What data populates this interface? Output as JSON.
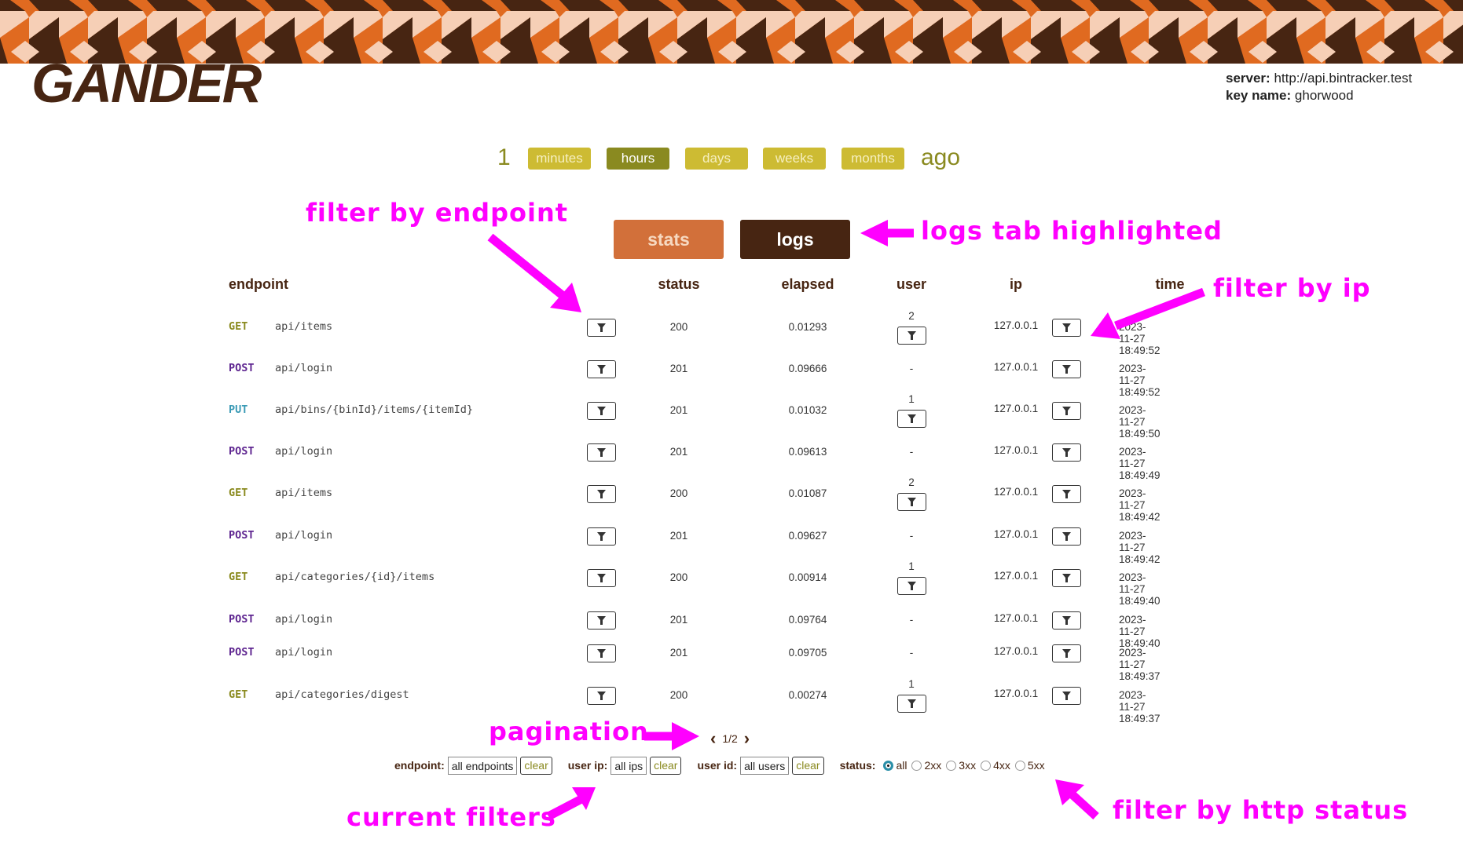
{
  "app": {
    "logo": "GANDER",
    "server_label": "server:",
    "server": "http://api.bintracker.test",
    "key_label": "key name:",
    "key": "ghorwood"
  },
  "range": {
    "value": "1",
    "units": [
      {
        "label": "minutes",
        "active": false
      },
      {
        "label": "hours",
        "active": true
      },
      {
        "label": "days",
        "active": false
      },
      {
        "label": "weeks",
        "active": false
      },
      {
        "label": "months",
        "active": false
      }
    ],
    "suffix": "ago"
  },
  "tabs": {
    "stats": "stats",
    "logs": "logs",
    "active": "logs"
  },
  "columns": {
    "endpoint": "endpoint",
    "status": "status",
    "elapsed": "elapsed",
    "user": "user",
    "ip": "ip",
    "time": "time"
  },
  "colors": {
    "GET": "#8a8a1e",
    "POST": "#5e2590",
    "PUT": "#3a9ab5"
  },
  "rows": [
    {
      "method": "GET",
      "path": "api/items",
      "status": "200",
      "elapsed": "0.01293",
      "user": "2",
      "ip": "127.0.0.1",
      "time": "2023-11-27 18:49:52"
    },
    {
      "method": "POST",
      "path": "api/login",
      "status": "201",
      "elapsed": "0.09666",
      "user": "-",
      "ip": "127.0.0.1",
      "time": "2023-11-27 18:49:52"
    },
    {
      "method": "PUT",
      "path": "api/bins/{binId}/items/{itemId}",
      "status": "201",
      "elapsed": "0.01032",
      "user": "1",
      "ip": "127.0.0.1",
      "time": "2023-11-27 18:49:50"
    },
    {
      "method": "POST",
      "path": "api/login",
      "status": "201",
      "elapsed": "0.09613",
      "user": "-",
      "ip": "127.0.0.1",
      "time": "2023-11-27 18:49:49"
    },
    {
      "method": "GET",
      "path": "api/items",
      "status": "200",
      "elapsed": "0.01087",
      "user": "2",
      "ip": "127.0.0.1",
      "time": "2023-11-27 18:49:42"
    },
    {
      "method": "POST",
      "path": "api/login",
      "status": "201",
      "elapsed": "0.09627",
      "user": "-",
      "ip": "127.0.0.1",
      "time": "2023-11-27 18:49:42"
    },
    {
      "method": "GET",
      "path": "api/categories/{id}/items",
      "status": "200",
      "elapsed": "0.00914",
      "user": "1",
      "ip": "127.0.0.1",
      "time": "2023-11-27 18:49:40"
    },
    {
      "method": "POST",
      "path": "api/login",
      "status": "201",
      "elapsed": "0.09764",
      "user": "-",
      "ip": "127.0.0.1",
      "time": "2023-11-27 18:49:40"
    },
    {
      "method": "POST",
      "path": "api/login",
      "status": "201",
      "elapsed": "0.09705",
      "user": "-",
      "ip": "127.0.0.1",
      "time": "2023-11-27 18:49:37"
    },
    {
      "method": "GET",
      "path": "api/categories/digest",
      "status": "200",
      "elapsed": "0.00274",
      "user": "1",
      "ip": "127.0.0.1",
      "time": "2023-11-27 18:49:37"
    }
  ],
  "pagination": {
    "prev": "‹",
    "page": "1/2",
    "next": "›"
  },
  "filters": {
    "endpoint_label": "endpoint:",
    "endpoint": "all endpoints",
    "ip_label": "user ip:",
    "ip": "all ips",
    "user_label": "user id:",
    "user": "all users",
    "clear": "clear",
    "status_label": "status:",
    "status_options": [
      "all",
      "2xx",
      "3xx",
      "4xx",
      "5xx"
    ],
    "status_selected": "all"
  },
  "annotations": {
    "endpoint": "filter by endpoint",
    "logs": "logs tab highlighted",
    "ip": "filter by ip",
    "pagination": "pagination",
    "current": "current filters",
    "status": "filter by http status"
  }
}
